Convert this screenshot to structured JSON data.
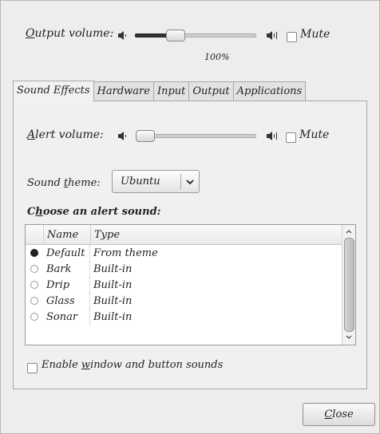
{
  "output": {
    "label_prefix": "O",
    "label_rest": "utput volume:",
    "percent_text": "100%",
    "level": 0.3,
    "mute_label": "Mute"
  },
  "tabs": [
    {
      "label": "Sound Effects",
      "active": true
    },
    {
      "label": "Hardware",
      "active": false
    },
    {
      "label": "Input",
      "active": false
    },
    {
      "label": "Output",
      "active": false
    },
    {
      "label": "Applications",
      "active": false
    }
  ],
  "alert": {
    "label_prefix": "A",
    "label_rest": "lert volume:",
    "level": 0.0,
    "mute_label": "Mute"
  },
  "theme": {
    "label_before": "Sound ",
    "label_u": "t",
    "label_after": "heme:",
    "value": "Ubuntu"
  },
  "choose": {
    "label_prefix": "C",
    "label_u": "h",
    "label_rest": "oose an alert sound:"
  },
  "list": {
    "col_name": "Name",
    "col_type": "Type",
    "rows": [
      {
        "name": "Default",
        "type": "From theme",
        "selected": true
      },
      {
        "name": "Bark",
        "type": "Built-in",
        "selected": false
      },
      {
        "name": "Drip",
        "type": "Built-in",
        "selected": false
      },
      {
        "name": "Glass",
        "type": "Built-in",
        "selected": false
      },
      {
        "name": "Sonar",
        "type": "Built-in",
        "selected": false
      }
    ]
  },
  "enable": {
    "label_before": "Enable ",
    "label_u": "w",
    "label_after": "indow and button sounds"
  },
  "close": {
    "label_u": "C",
    "label_rest": "lose"
  }
}
